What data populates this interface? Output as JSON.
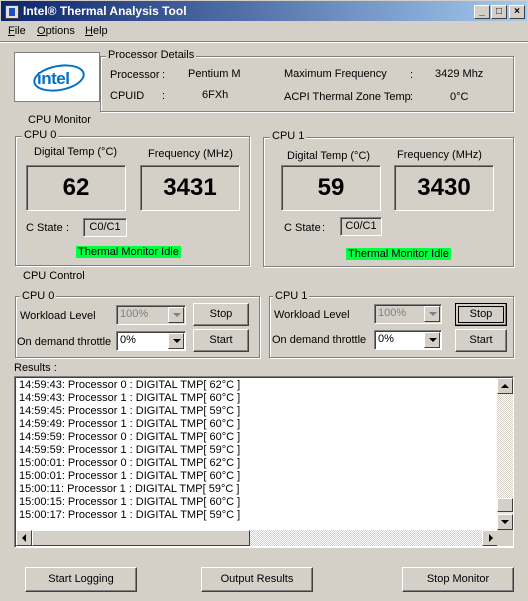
{
  "window": {
    "title": "Intel® Thermal Analysis Tool",
    "minimize_glyph": "_",
    "maximize_glyph": "□",
    "close_glyph": "×"
  },
  "menu": [
    {
      "label": "File",
      "accel": "F",
      "rest": "ile"
    },
    {
      "label": "Options",
      "accel": "O",
      "rest": "ptions"
    },
    {
      "label": "Help",
      "accel": "H",
      "rest": "elp"
    }
  ],
  "processor_details": {
    "group_label": "Processor Details",
    "logo_text": "intel",
    "processor_label": "Processor",
    "processor_value": "Pentium M",
    "cpuid_label": "CPUID",
    "cpuid_value": "6FXh",
    "max_freq_label": "Maximum Frequency",
    "max_freq_value": "3429 Mhz",
    "acpi_label": "ACPI Thermal Zone Temp",
    "acpi_value": "0°C",
    "colon": ":"
  },
  "cpu_monitor": {
    "label": "CPU Monitor",
    "cpus": [
      {
        "label": "CPU 0",
        "temp_label": "Digital Temp (°C)",
        "temp_value": "62",
        "freq_label": "Frequency (MHz)",
        "freq_value": "3431",
        "cstate_label": "C State",
        "cstate_value": "C0/C1",
        "status": "Thermal Monitor Idle"
      },
      {
        "label": "CPU 1",
        "temp_label": "Digital Temp (°C)",
        "temp_value": "59",
        "freq_label": "Frequency (MHz)",
        "freq_value": "3430",
        "cstate_label": "C State",
        "cstate_value": "C0/C1",
        "status": "Thermal Monitor Idle"
      }
    ]
  },
  "cpu_control": {
    "label": "CPU Control",
    "cpus": [
      {
        "label": "CPU 0",
        "workload_label": "Workload  Level",
        "workload_value": "100%",
        "stop_label": "Stop",
        "throttle_label": "On demand throttle",
        "throttle_value": "0%",
        "start_label": "Start"
      },
      {
        "label": "CPU 1",
        "workload_label": "Workload  Level",
        "workload_value": "100%",
        "stop_label": "Stop",
        "throttle_label": "On demand throttle",
        "throttle_value": "0%",
        "start_label": "Start"
      }
    ]
  },
  "results": {
    "label": "Results :",
    "lines": [
      "14:59:43: Processor 0 : DIGITAL TMP[ 62°C ]",
      "14:59:43: Processor 1 : DIGITAL TMP[ 60°C ]",
      "14:59:45: Processor 1 : DIGITAL TMP[ 59°C ]",
      "14:59:49: Processor 1 : DIGITAL TMP[ 60°C ]",
      "14:59:59: Processor 0 : DIGITAL TMP[ 60°C ]",
      "14:59:59: Processor 1 : DIGITAL TMP[ 59°C ]",
      "15:00:01: Processor 0 : DIGITAL TMP[ 62°C ]",
      "15:00:01: Processor 1 : DIGITAL TMP[ 60°C ]",
      "15:00:11: Processor 1 : DIGITAL TMP[ 59°C ]",
      "15:00:15: Processor 1 : DIGITAL TMP[ 60°C ]",
      "15:00:17: Processor 1 : DIGITAL TMP[ 59°C ]"
    ]
  },
  "footer": {
    "start_logging": "Start Logging",
    "output_results": "Output Results",
    "stop_monitor": "Stop Monitor"
  },
  "colors": {
    "title_gradient_start": "#0a246a",
    "status_green": "#00ff40",
    "intel_blue": "#0071c5"
  }
}
